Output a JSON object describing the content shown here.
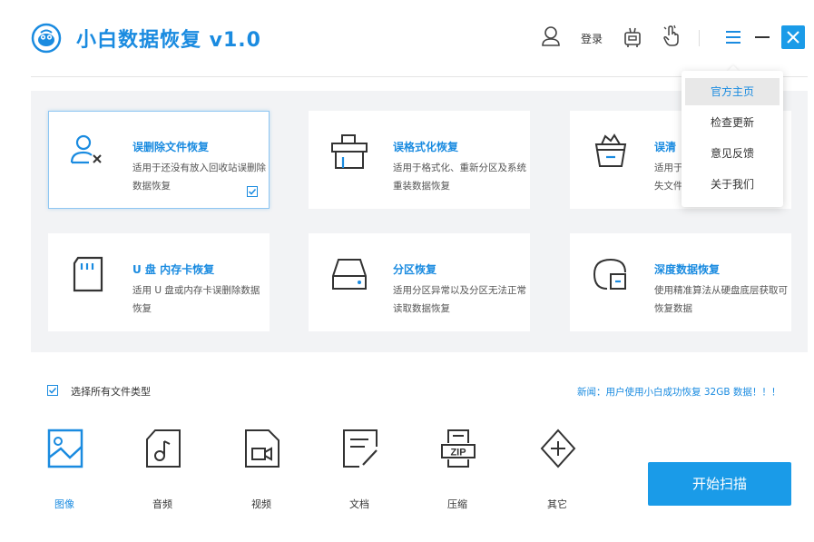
{
  "app": {
    "title": "小白数据恢复 v1.0"
  },
  "header": {
    "login_label": "登录"
  },
  "menu": {
    "items": [
      "官方主页",
      "检查更新",
      "意见反馈",
      "关于我们"
    ]
  },
  "cards": [
    {
      "title": "误删除文件恢复",
      "desc": "适用于还没有放入回收站误删除数据恢复"
    },
    {
      "title": "误格式化恢复",
      "desc": "适用于格式化、重新分区及系统重装数据恢复"
    },
    {
      "title": "误清",
      "desc": "适用于失文件"
    },
    {
      "title": "U 盘 内存卡恢复",
      "desc": "适用 U 盘或内存卡误删除数据恢复"
    },
    {
      "title": "分区恢复",
      "desc": "适用分区异常以及分区无法正常读取数据恢复"
    },
    {
      "title": "深度数据恢复",
      "desc": "使用精准算法从硬盘底层获取可恢复数据"
    }
  ],
  "select_all_label": "选择所有文件类型",
  "news": "新闻：用户使用小白成功恢复 32GB 数据！！！",
  "file_types": [
    "图像",
    "音频",
    "视频",
    "文档",
    "压缩",
    "其它"
  ],
  "scan_button": "开始扫描",
  "colors": {
    "accent": "#1a8be0",
    "button": "#1a9be8"
  }
}
